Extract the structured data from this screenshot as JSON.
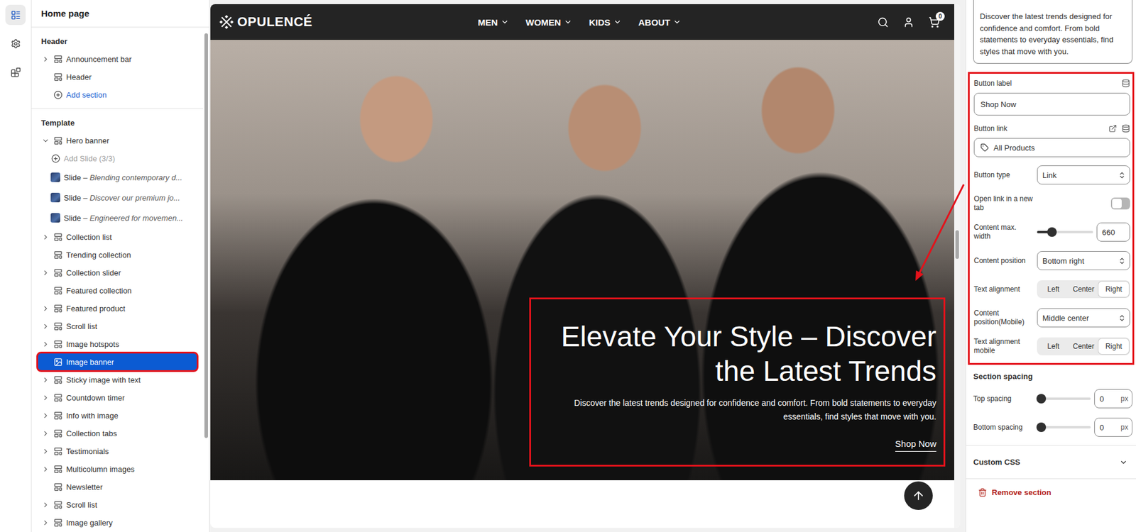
{
  "rail": {
    "items": [
      {
        "selected": true
      },
      {
        "selected": false
      },
      {
        "selected": false
      }
    ]
  },
  "sidebar": {
    "title": "Home page",
    "groups": [
      {
        "label": "Header",
        "items": [
          {
            "kind": "section",
            "label": "Announcement bar",
            "chevron": true,
            "expanded": false,
            "selected": false
          },
          {
            "kind": "section",
            "label": "Header",
            "chevron": false,
            "expanded": false,
            "selected": false
          },
          {
            "kind": "add",
            "label": "Add section",
            "selected": false
          }
        ]
      },
      {
        "label": "Template",
        "items": [
          {
            "kind": "section",
            "label": "Hero banner",
            "chevron": true,
            "expanded": true,
            "selected": false
          },
          {
            "kind": "add-slide",
            "label": "Add Slide (3/3)",
            "disabled": true,
            "selected": false
          },
          {
            "kind": "slide",
            "label": "Slide",
            "detail": "– Blending contemporary d...",
            "selected": false
          },
          {
            "kind": "slide",
            "label": "Slide",
            "detail": "– Discover our premium jo...",
            "selected": false
          },
          {
            "kind": "slide",
            "label": "Slide",
            "detail": "– Engineered for movemen...",
            "selected": false
          },
          {
            "kind": "section",
            "label": "Collection list",
            "chevron": true,
            "expanded": false,
            "selected": false
          },
          {
            "kind": "section",
            "label": "Trending collection",
            "chevron": false,
            "expanded": false,
            "selected": false
          },
          {
            "kind": "section",
            "label": "Collection slider",
            "chevron": true,
            "expanded": false,
            "selected": false
          },
          {
            "kind": "section",
            "label": "Featured collection",
            "chevron": false,
            "expanded": false,
            "selected": false
          },
          {
            "kind": "section",
            "label": "Featured product",
            "chevron": true,
            "expanded": false,
            "selected": false
          },
          {
            "kind": "section",
            "label": "Scroll list",
            "chevron": true,
            "expanded": false,
            "selected": false
          },
          {
            "kind": "section",
            "label": "Image hotspots",
            "chevron": true,
            "expanded": false,
            "selected": false
          },
          {
            "kind": "section",
            "label": "Image banner",
            "chevron": false,
            "expanded": false,
            "selected": true
          },
          {
            "kind": "section",
            "label": "Sticky image with text",
            "chevron": true,
            "expanded": false,
            "selected": false
          },
          {
            "kind": "section",
            "label": "Countdown timer",
            "chevron": true,
            "expanded": false,
            "selected": false
          },
          {
            "kind": "section",
            "label": "Info with image",
            "chevron": true,
            "expanded": false,
            "selected": false
          },
          {
            "kind": "section",
            "label": "Collection tabs",
            "chevron": true,
            "expanded": false,
            "selected": false
          },
          {
            "kind": "section",
            "label": "Testimonials",
            "chevron": true,
            "expanded": false,
            "selected": false
          },
          {
            "kind": "section",
            "label": "Multicolumn images",
            "chevron": true,
            "expanded": false,
            "selected": false
          },
          {
            "kind": "section",
            "label": "Newsletter",
            "chevron": false,
            "expanded": false,
            "selected": false
          },
          {
            "kind": "section",
            "label": "Scroll list",
            "chevron": true,
            "expanded": false,
            "selected": false
          },
          {
            "kind": "section",
            "label": "Image gallery",
            "chevron": true,
            "expanded": false,
            "selected": false
          }
        ]
      }
    ]
  },
  "preview": {
    "logo": "OPULENCÉ",
    "nav": [
      {
        "label": "MEN"
      },
      {
        "label": "WOMEN"
      },
      {
        "label": "KIDS"
      },
      {
        "label": "ABOUT"
      }
    ],
    "cart_count": "0",
    "banner": {
      "heading": "Elevate Your Style – Discover the Latest Trends",
      "text": "Discover the latest trends designed for confidence and comfort. From bold statements to everyday essentials, find styles that move with you.",
      "button": "Shop Now"
    }
  },
  "settings": {
    "description": "Discover the latest trends designed for confidence and comfort. From bold statements to everyday essentials, find styles that move with you.",
    "fields": [
      {
        "kind": "text",
        "label": "Button label",
        "value": "Shop Now"
      },
      {
        "kind": "link",
        "label": "Button link",
        "value": "All Products"
      },
      {
        "kind": "select",
        "label": "Button type",
        "value": "Link"
      },
      {
        "kind": "toggle",
        "label": "Open link in a new tab",
        "on": false
      },
      {
        "kind": "range",
        "label": "Content max. width",
        "value": "660",
        "level": 0.27
      },
      {
        "kind": "select",
        "label": "Content position",
        "value": "Bottom right"
      },
      {
        "kind": "segmented",
        "label": "Text alignment",
        "options": [
          {
            "label": "Left",
            "selected": false
          },
          {
            "label": "Center",
            "selected": false
          },
          {
            "label": "Right",
            "selected": true
          }
        ]
      },
      {
        "kind": "select",
        "label": "Content position(Mobile)",
        "value": "Middle center"
      },
      {
        "kind": "segmented",
        "label": "Text alignment mobile",
        "options": [
          {
            "label": "Left",
            "selected": false
          },
          {
            "label": "Center",
            "selected": false
          },
          {
            "label": "Right",
            "selected": true
          }
        ]
      }
    ],
    "spacing": {
      "title": "Section spacing",
      "items": [
        {
          "label": "Top spacing",
          "value": "0",
          "unit": "px",
          "level": 0
        },
        {
          "label": "Bottom spacing",
          "value": "0",
          "unit": "px",
          "level": 0
        }
      ]
    },
    "custom_css": {
      "label": "Custom CSS",
      "expanded": false
    },
    "remove": "Remove section"
  }
}
